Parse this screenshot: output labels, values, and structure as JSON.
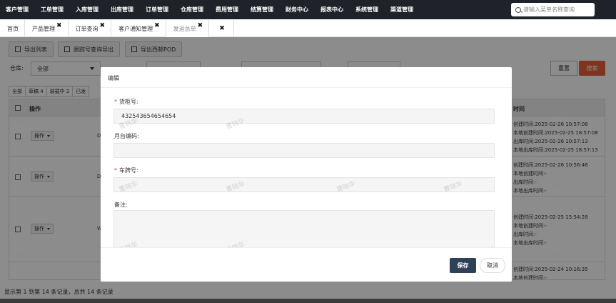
{
  "nav": {
    "items": [
      "客户管理",
      "工单管理",
      "入库管理",
      "出库管理",
      "订单管理",
      "仓库管理",
      "费用管理",
      "结算管理",
      "财务中心",
      "报表中心",
      "系统管理",
      "渠道管理"
    ],
    "search_placeholder": "请输入菜单名称查询"
  },
  "tabs": [
    {
      "label": "首页",
      "closable": false
    },
    {
      "label": "产品管理",
      "closable": true
    },
    {
      "label": "订单查询",
      "closable": true
    },
    {
      "label": "客户通知管理",
      "closable": true
    },
    {
      "label": "发运总单",
      "closable": true,
      "active": true
    },
    {
      "label": "",
      "closable": true
    }
  ],
  "toolbar": {
    "export_list": "导出列表",
    "export_tracking": "跟踪号查询导出",
    "export_pod": "导出西邮POD"
  },
  "filters": {
    "warehouse_label": "仓库:",
    "warehouse_value": "全部",
    "reset": "重置",
    "search": "搜索"
  },
  "status_tabs": [
    "全部",
    "草稿 4",
    "装载中 2",
    "已发"
  ],
  "table": {
    "col_op": "操作",
    "col_time": "时间",
    "op_button": "操作",
    "rows": [
      {
        "char": "D",
        "times": [
          "创建时间:2025-02-26 10:57:08",
          "本地创建时间:2025-02-25 18:57:08",
          "出库时间:2025-02-26 10:57:13",
          "本地出库时间:2025-02-25 18:57:13"
        ]
      },
      {
        "char": "D",
        "times": [
          "创建时间:2025-02-26 10:56:46",
          "本地创建时间:-",
          "出库时间:-",
          "本地出库时间:-"
        ]
      },
      {
        "char": "W",
        "times": [
          "创建时间:2025-02-25 15:54:28",
          "本地创建时间:-",
          "出库时间:-",
          "本地出库时间:-"
        ]
      },
      {
        "char": "",
        "times": [
          "创建时间:2025-02-24 10:16:35",
          "本地创建时间:-"
        ]
      }
    ]
  },
  "footer_note": "显示第 1 到第 14 条记录，总共 14 条记录",
  "modal": {
    "title": "编辑",
    "fields": {
      "container_label": "货柜号:",
      "container_value": "432543654654654",
      "dock_label": "月台编码:",
      "dock_value": "",
      "plate_label": "车牌号:",
      "plate_value": "",
      "remark_label": "备注:",
      "remark_value": ""
    },
    "save": "保存",
    "cancel": "取消"
  },
  "watermark": "曹晓华",
  "colors": {
    "nav_bg": "#1f2329",
    "primary": "#2f4158",
    "search_btn": "#e8603a",
    "required": "#e5412f"
  }
}
